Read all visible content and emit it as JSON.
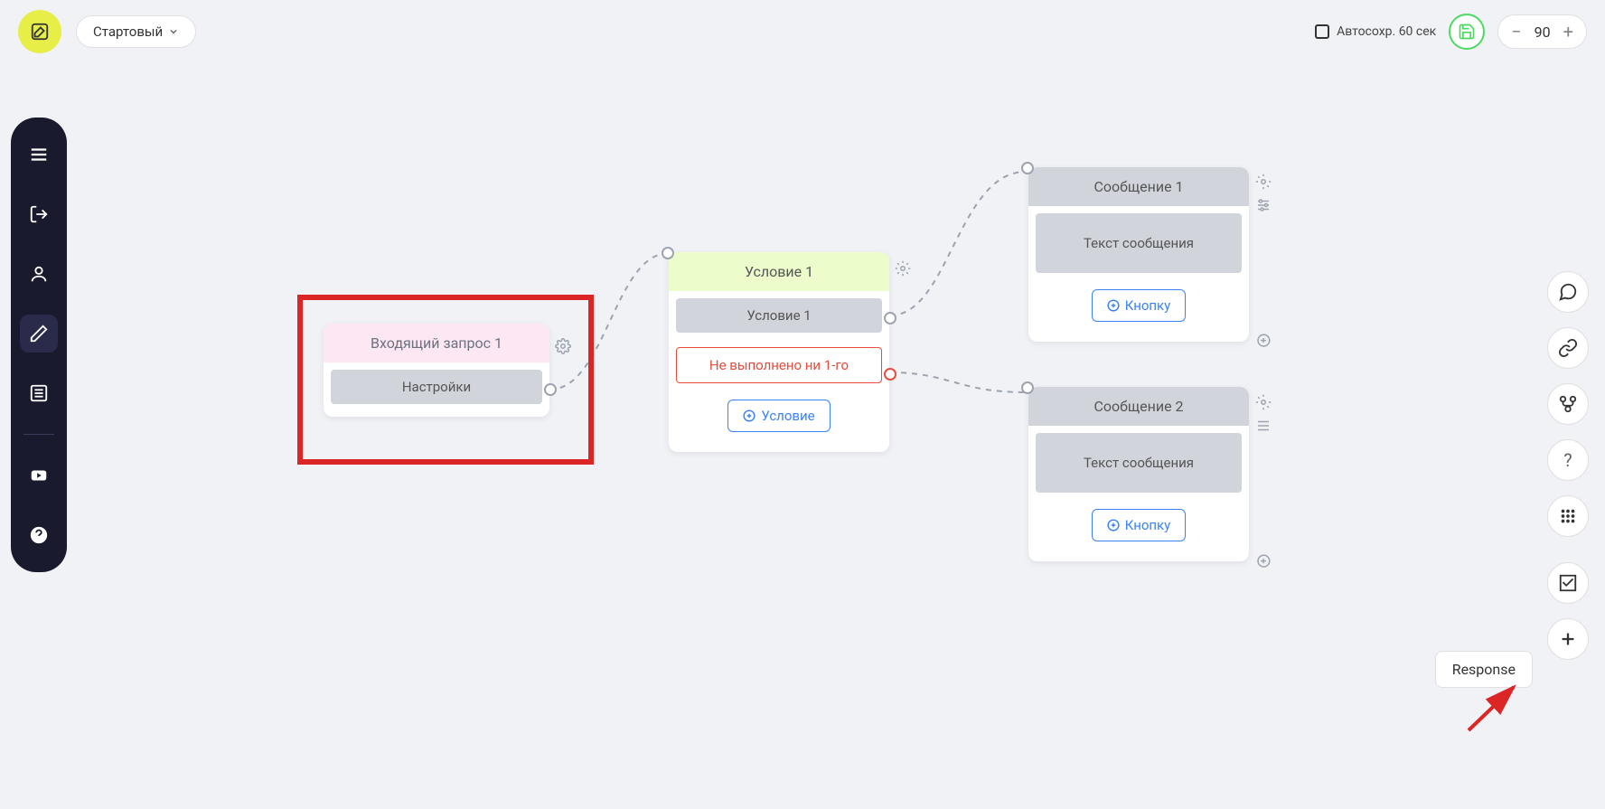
{
  "topbar": {
    "scenario_label": "Стартовый",
    "autosave_label": "Автосохр. 60 сек",
    "zoom_minus": "−",
    "zoom_value": "90",
    "zoom_plus": "+"
  },
  "response_tooltip": "Response",
  "node_request": {
    "title": "Входящий запрос 1",
    "settings": "Настройки"
  },
  "node_condition": {
    "title": "Условие 1",
    "cond_label": "Условие 1",
    "fallback": "Не выполнено ни 1-го",
    "add_label": "Условие"
  },
  "node_msg1": {
    "title": "Сообщение 1",
    "text": "Текст сообщения",
    "add_label": "Кнопку"
  },
  "node_msg2": {
    "title": "Сообщение 2",
    "text": "Текст сообщения",
    "add_label": "Кнопку"
  }
}
